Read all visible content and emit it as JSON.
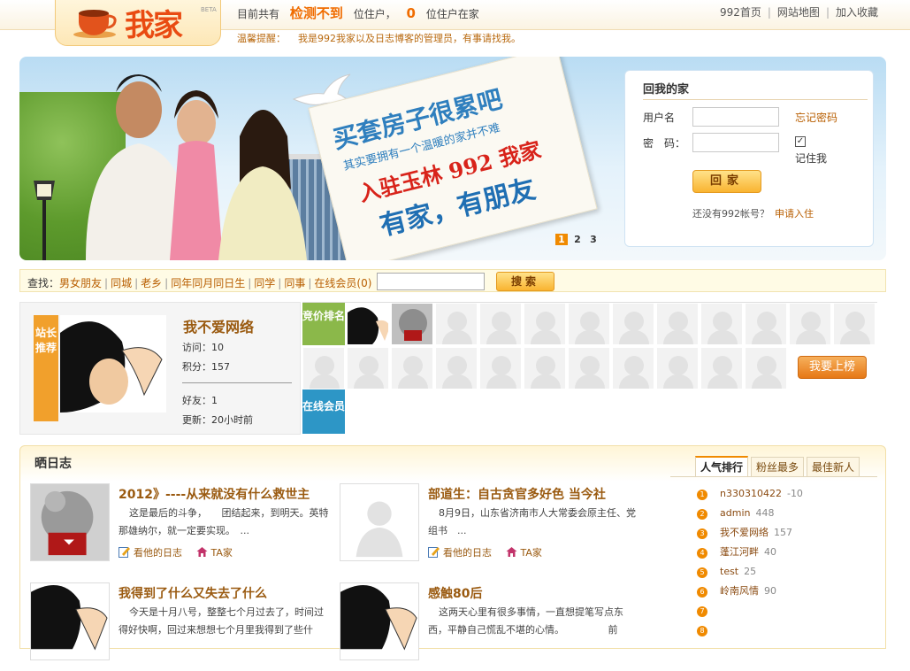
{
  "header": {
    "logo_text": "我家",
    "beta": "BETA",
    "stats_prefix": "目前共有",
    "stats_value1": "检测不到",
    "stats_mid": "位住户，",
    "stats_value2": "0",
    "stats_suffix": "位住户在家",
    "links": [
      "992首页",
      "网站地图",
      "加入收藏"
    ],
    "tip_label": "温馨提醒：",
    "tip_text": "我是992我家以及日志博客的管理员，有事请找我。"
  },
  "banner": {
    "sign_line1": "买套房子很累吧",
    "sign_line2": "其实要拥有一个温暖的家并不难",
    "sign_line3": "入驻玉林 992 我家",
    "sign_line4": "有家，有朋友",
    "slides": [
      "1",
      "2",
      "3"
    ]
  },
  "login": {
    "title": "回我的家",
    "username_label": "用户名",
    "password_label": "密　码：",
    "forgot": "忘记密码",
    "remember_check": "✓",
    "remember": "记住我",
    "button": "回家",
    "no_account": "还没有992帐号？",
    "register": "申请入住"
  },
  "search": {
    "label": "查找：",
    "links": [
      "男女朋友",
      "同城",
      "老乡",
      "同年同月同日生",
      "同学",
      "同事",
      "在线会员(0)"
    ],
    "button": "搜索"
  },
  "recommend": {
    "tag": "站长推荐",
    "name": "我不爱网络",
    "visits": "访问：10",
    "points": "积分：157",
    "friends": "好友：1",
    "updated": "更新：20小时前"
  },
  "ranking": {
    "label": "竞价排名",
    "online_label": "在线会员",
    "cta": "我要上榜"
  },
  "diary": {
    "title": "晒日志",
    "posts": [
      {
        "title": "2012》----从来就没有什么救世主",
        "body": "这是最后的斗争，　　团结起来，到明天。英特那雄纳尔，就一定要实现。　...",
        "act1": "看他的日志",
        "act2": "TA家"
      },
      {
        "title": "部道生：自古贪官多好色 当今社",
        "body": "8月9日，山东省济南市人大常委会原主任、党组书　...",
        "act1": "看他的日志",
        "act2": "TA家"
      },
      {
        "title": "我得到了什么又失去了什么",
        "body": "今天是十月八号，整整七个月过去了，时间过得好快啊，回过来想想七个月里我得到了些什",
        "act1": "",
        "act2": ""
      },
      {
        "title": "感触80后",
        "body": "这两天心里有很多事情，一直想提笔写点东西，平静自己慌乱不堪的心情。　　　　　前",
        "act1": "",
        "act2": ""
      }
    ]
  },
  "popularity": {
    "tabs": [
      "人气排行",
      "粉丝最多",
      "最佳新人"
    ],
    "items": [
      {
        "n": "1",
        "user": "n330310422",
        "count": "-10"
      },
      {
        "n": "2",
        "user": "admin",
        "count": "448"
      },
      {
        "n": "3",
        "user": "我不爱网络",
        "count": "157"
      },
      {
        "n": "4",
        "user": "蓬江河畔",
        "count": "40"
      },
      {
        "n": "5",
        "user": "test",
        "count": "25"
      },
      {
        "n": "6",
        "user": "岭南风情",
        "count": "90"
      },
      {
        "n": "7",
        "user": "",
        "count": ""
      },
      {
        "n": "8",
        "user": "",
        "count": ""
      }
    ]
  }
}
